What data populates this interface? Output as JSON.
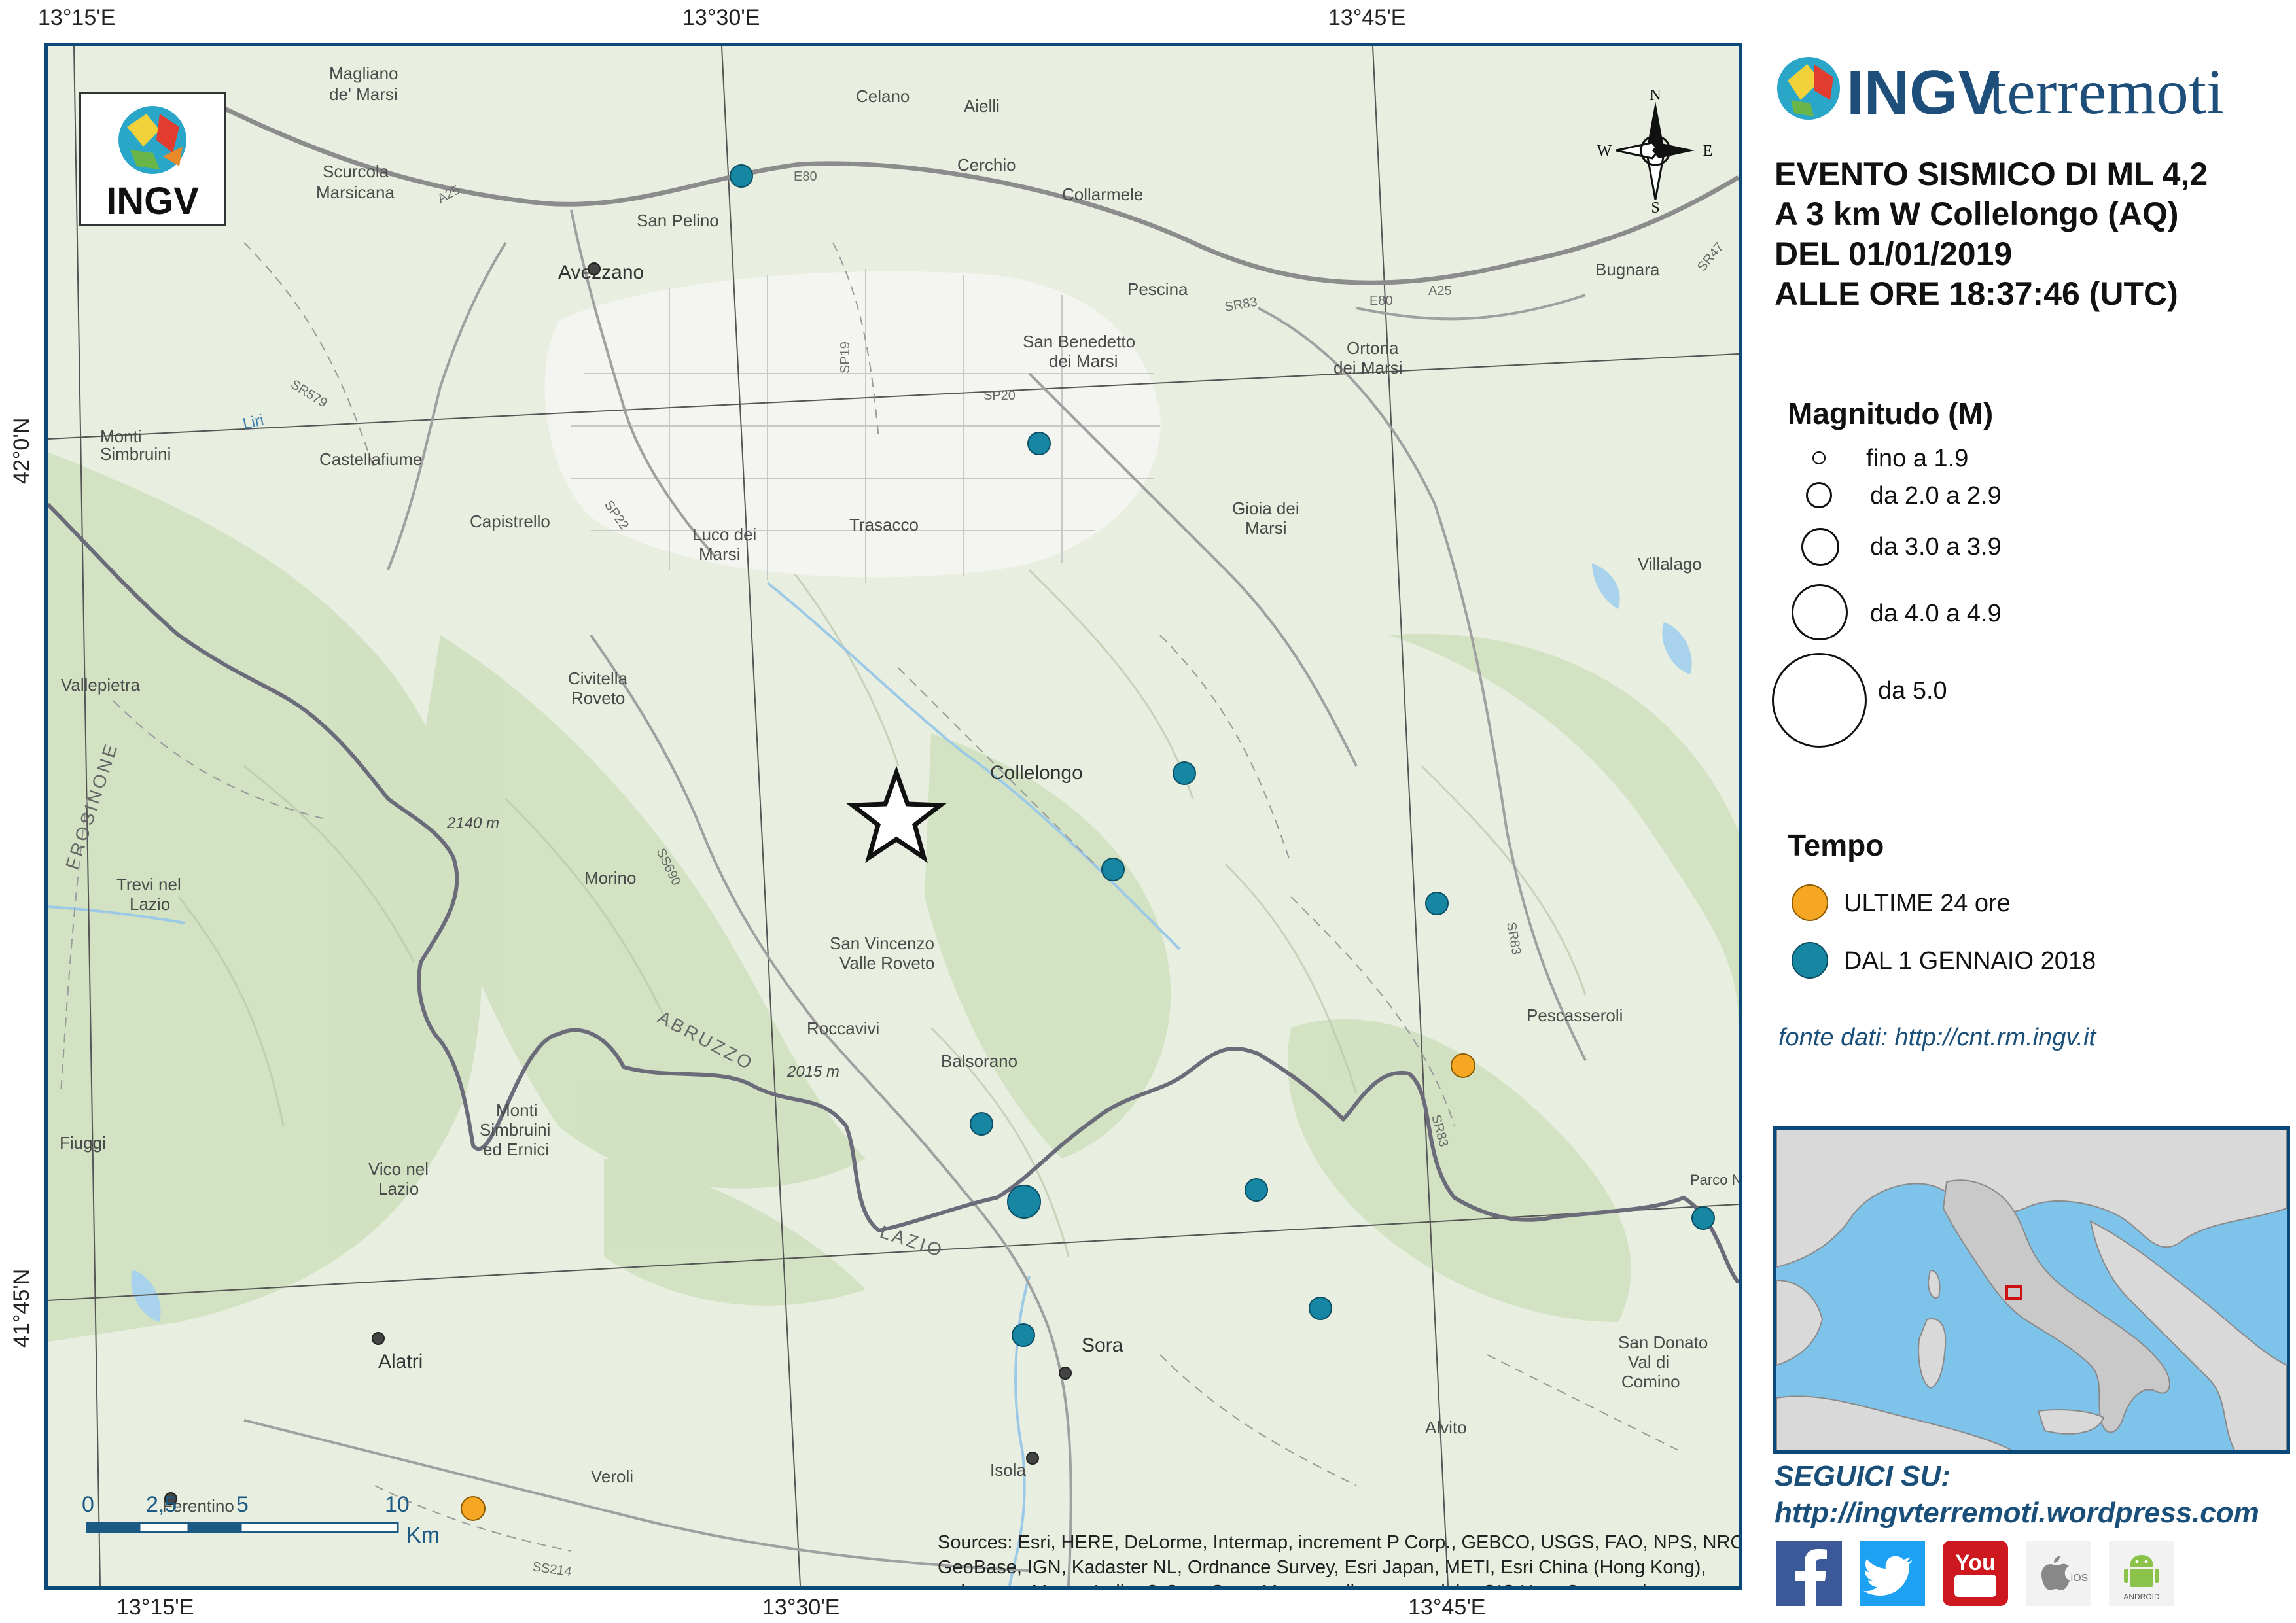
{
  "map": {
    "coords_top": [
      "13°15'E",
      "13°30'E",
      "13°45'E"
    ],
    "coords_bottom": [
      "13°15'E",
      "13°30'E",
      "13°45'E"
    ],
    "coords_left": [
      "42°0'N",
      "41°45'N"
    ],
    "places": {
      "magliano": "Magliano de' Marsi",
      "celano": "Celano",
      "aielli": "Aielli",
      "cerchio": "Cerchio",
      "collarmele": "Collarmele",
      "scurcola": "Scurcola Marsicana",
      "san_pelino": "San Pelino",
      "avezzano": "Avezzano",
      "pescina": "Pescina",
      "bugnara": "Bugnara",
      "san_benedetto": "San Benedetto dei Marsi",
      "ortona": "Ortona dei Marsi",
      "castellafiume": "Castellafiume",
      "monti_simbruini": "Monti Simbruini",
      "capistrello": "Capistrello",
      "luco": "Luco dei Marsi",
      "trasacco": "Trasacco",
      "gioia": "Gioia dei Marsi",
      "villalago": "Villalago",
      "vallepietra": "Vallepietra",
      "civitella": "Civitella Roveto",
      "collelongo": "Collelongo",
      "morino": "Morino",
      "trevi": "Trevi nel Lazio",
      "san_vincenzo": "San Vincenzo Valle Roveto",
      "pescasseroli": "Pescasseroli",
      "roccavivi": "Roccavivi",
      "balsorano": "Balsorano",
      "monti_ernici": "Monti Simbruini ed Ernici",
      "fiuggi": "Fiuggi",
      "vico": "Vico nel Lazio",
      "alatri": "Alatri",
      "sora": "Sora",
      "san_donato": "San Donato Val di Comino",
      "alvito": "Alvito",
      "veroli": "Veroli",
      "isola": "Isola",
      "ferentino": "Ferentino",
      "parco": "Parco Nazio"
    },
    "regions": {
      "abruzzo": "ABRUZZO",
      "lazio": "LAZIO",
      "frosinone": "FROSINONE"
    },
    "peaks": {
      "p2140": "2140 m",
      "p2015": "2015 m"
    },
    "roads": {
      "a25": "A25",
      "e80": "E80",
      "sr579": "SR579",
      "sp22": "SP22",
      "sp20": "SP20",
      "sp19": "SP19",
      "ss690": "SS690",
      "sr83": "SR83",
      "sr83b": "SR83",
      "sr83c": "SR83",
      "ss214": "SS214",
      "a25b": "A25",
      "e80b": "E80",
      "sr47": "SR47"
    },
    "water": {
      "liri": "Liri"
    },
    "scale": {
      "labels": [
        "0",
        "2,5",
        "5",
        "10"
      ],
      "unit": "Km"
    },
    "compass": {
      "n": "N",
      "s": "S",
      "e": "E",
      "w": "W"
    },
    "ingv_label": "INGV",
    "attribution": "Sources: Esri, HERE, DeLorme, Intermap, increment P Corp., GEBCO, USGS, FAO, NPS, NRCAN, GeoBase, IGN, Kadaster NL, Ordnance Survey, Esri Japan, METI, Esri China (Hong Kong), swisstopo, MapmyIndia, © OpenStreetMap contributors, and the GIS User Community"
  },
  "header": {
    "brand_bold": "INGV",
    "brand_light": "terremoti",
    "event_lines": [
      "EVENTO SISMICO DI ML 4,2",
      "A 3 km W Collelongo (AQ)",
      "DEL 01/01/2019",
      "ALLE ORE 18:37:46 (UTC)"
    ]
  },
  "legend": {
    "magnitude_title": "Magnitudo (M)",
    "magnitude_classes": [
      "fino a 1.9",
      "da 2.0 a 2.9",
      "da 3.0 a 3.9",
      "da 4.0 a 4.9",
      "da 5.0"
    ],
    "time_title": "Tempo",
    "time_classes": [
      "ULTIME 24 ore",
      "DAL 1 GENNAIO 2018"
    ],
    "colors": {
      "last24": "#f5a623",
      "since2018": "#1786a3"
    },
    "source": "fonte dati: http://cnt.rm.ingv.it"
  },
  "social": {
    "title": "SEGUICI SU:",
    "url": "http://ingvterremoti.wordpress.com",
    "ios_label": "iOS",
    "android_label": "ANDROID",
    "youtube_label": "You"
  }
}
